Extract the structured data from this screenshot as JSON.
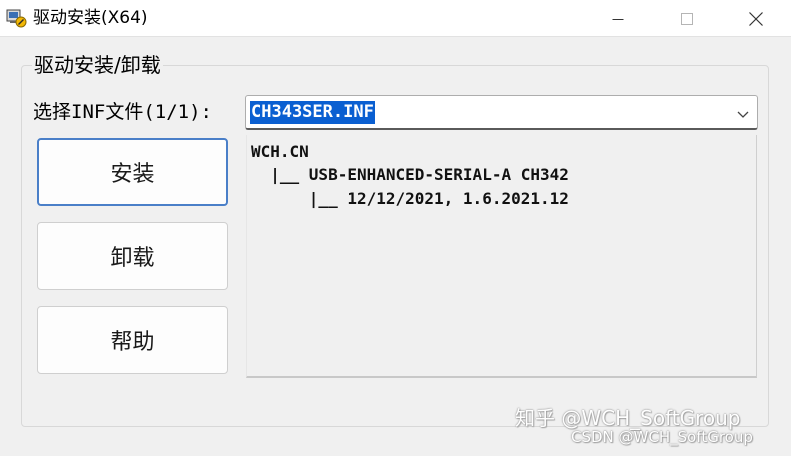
{
  "window": {
    "title": "驱动安装(X64)",
    "icon": "installer-icon",
    "controls": [
      "minimize-icon",
      "maximize-icon",
      "close-icon"
    ]
  },
  "group": {
    "label": "驱动安装/卸载"
  },
  "inf_select": {
    "label": "选择INF文件(1/1):",
    "selected_value": "CH343SER.INF",
    "arrow_icon": "chevron-down-icon"
  },
  "buttons": {
    "install": "安装",
    "uninstall": "卸载",
    "help": "帮助"
  },
  "driver_info": {
    "lines": [
      "WCH.CN",
      "  |__ USB-ENHANCED-SERIAL-A CH342",
      "      |__ 12/12/2021, 1.6.2021.12"
    ]
  },
  "watermarks": {
    "zhihu": "知乎 @WCH_SoftGroup",
    "csdn": "CSDN @WCH_SoftGroup"
  },
  "colors": {
    "selection": "#0a5fd1",
    "focus_border": "#4a7fc8",
    "background": "#f0f0f0"
  }
}
